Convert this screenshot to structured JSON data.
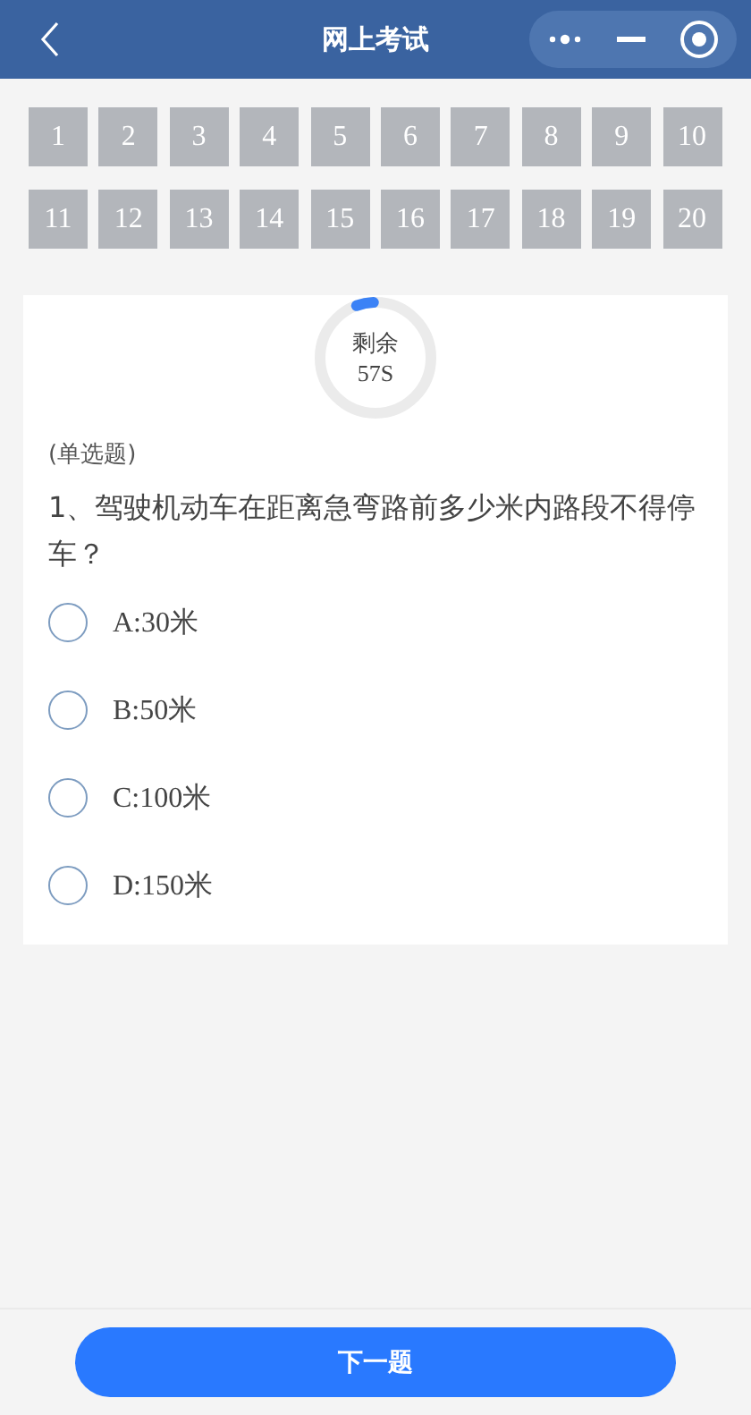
{
  "header": {
    "title": "网上考试"
  },
  "question_numbers": [
    "1",
    "2",
    "3",
    "4",
    "5",
    "6",
    "7",
    "8",
    "9",
    "10",
    "11",
    "12",
    "13",
    "14",
    "15",
    "16",
    "17",
    "18",
    "19",
    "20"
  ],
  "timer": {
    "label": "剩余",
    "value": "57S",
    "level": 0.05
  },
  "question": {
    "type": "(单选题)",
    "text": "1、驾驶机动车在距离急弯路前多少米内路段不得停车？",
    "options": [
      {
        "label": "A:30米",
        "selected": false
      },
      {
        "label": "B:50米",
        "selected": false
      },
      {
        "label": "C:100米",
        "selected": false
      },
      {
        "label": "D:150米",
        "selected": false
      }
    ]
  },
  "next_button": "下一题"
}
